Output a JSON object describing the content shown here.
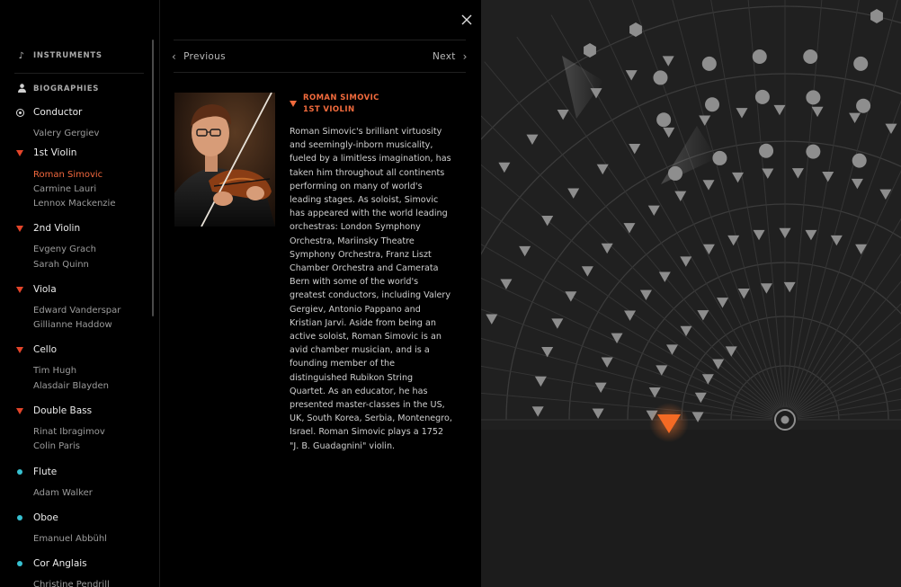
{
  "sidebar": {
    "instruments_label": "INSTRUMENTS",
    "instruments_icon": "music-note-icon",
    "biographies_label": "BIOGRAPHIES",
    "biographies_icon": "person-icon",
    "groups": [
      {
        "label": "Conductor",
        "marker": "ring",
        "members": [
          "Valery Gergiev"
        ]
      },
      {
        "label": "1st Violin",
        "marker": "triangle",
        "members": [
          "Roman Simovic",
          "Carmine Lauri",
          "Lennox Mackenzie"
        ]
      },
      {
        "label": "2nd Violin",
        "marker": "triangle",
        "members": [
          "Evgeny Grach",
          "Sarah Quinn"
        ]
      },
      {
        "label": "Viola",
        "marker": "triangle",
        "members": [
          "Edward Vanderspar",
          "Gillianne Haddow"
        ]
      },
      {
        "label": "Cello",
        "marker": "triangle",
        "members": [
          "Tim Hugh",
          "Alasdair Blayden"
        ]
      },
      {
        "label": "Double Bass",
        "marker": "triangle",
        "members": [
          "Rinat Ibragimov",
          "Colin Paris"
        ]
      },
      {
        "label": "Flute",
        "marker": "dot",
        "members": [
          "Adam Walker"
        ]
      },
      {
        "label": "Oboe",
        "marker": "dot",
        "members": [
          "Emanuel Abbühl"
        ]
      },
      {
        "label": "Cor Anglais",
        "marker": "dot",
        "members": [
          "Christine Pendrill"
        ]
      }
    ],
    "selected_member": "Roman Simovic"
  },
  "nav": {
    "previous_label": "Previous",
    "next_label": "Next"
  },
  "bio": {
    "name": "ROMAN SIMOVIC",
    "role": "1ST VIOLIN",
    "lines": [
      "Roman Simovic's brilliant virtuosity",
      "and seemingly-inborn musicality,",
      "fueled by a limitless imagination, has",
      "taken him throughout all continents",
      "performing on many of world's",
      "leading stages. As soloist, Simovic",
      "has appeared with the world leading",
      "orchestras: London Symphony",
      "Orchestra, Mariinsky Theatre",
      "Symphony Orchestra, Franz Liszt",
      "Chamber Orchestra and Camerata",
      "Bern with some of the world's",
      "greatest conductors, including Valery",
      "Gergiev, Antonio Pappano and",
      "Kristian Jarvi. Aside from being an",
      "active soloist, Roman Simovic is an",
      "avid chamber musician, and is a",
      "founding member of the",
      "distinguished Rubikon String",
      "Quartet. As an educator, he has",
      "presented master-classes in the US,",
      "UK, South Korea, Serbia, Montenegro,",
      "Israel. Roman Simovic plays a 1752",
      "\"J. B. Guadagnini\" violin."
    ]
  },
  "colors": {
    "accent": "#f26b3d",
    "string_marker": "#e4452a",
    "wind_marker": "#37c1d1",
    "viz_background": "#202020"
  },
  "icons": {
    "close": "close-icon",
    "previous": "chevron-left-icon",
    "next": "chevron-right-icon",
    "conductor_podium": "target-icon"
  }
}
